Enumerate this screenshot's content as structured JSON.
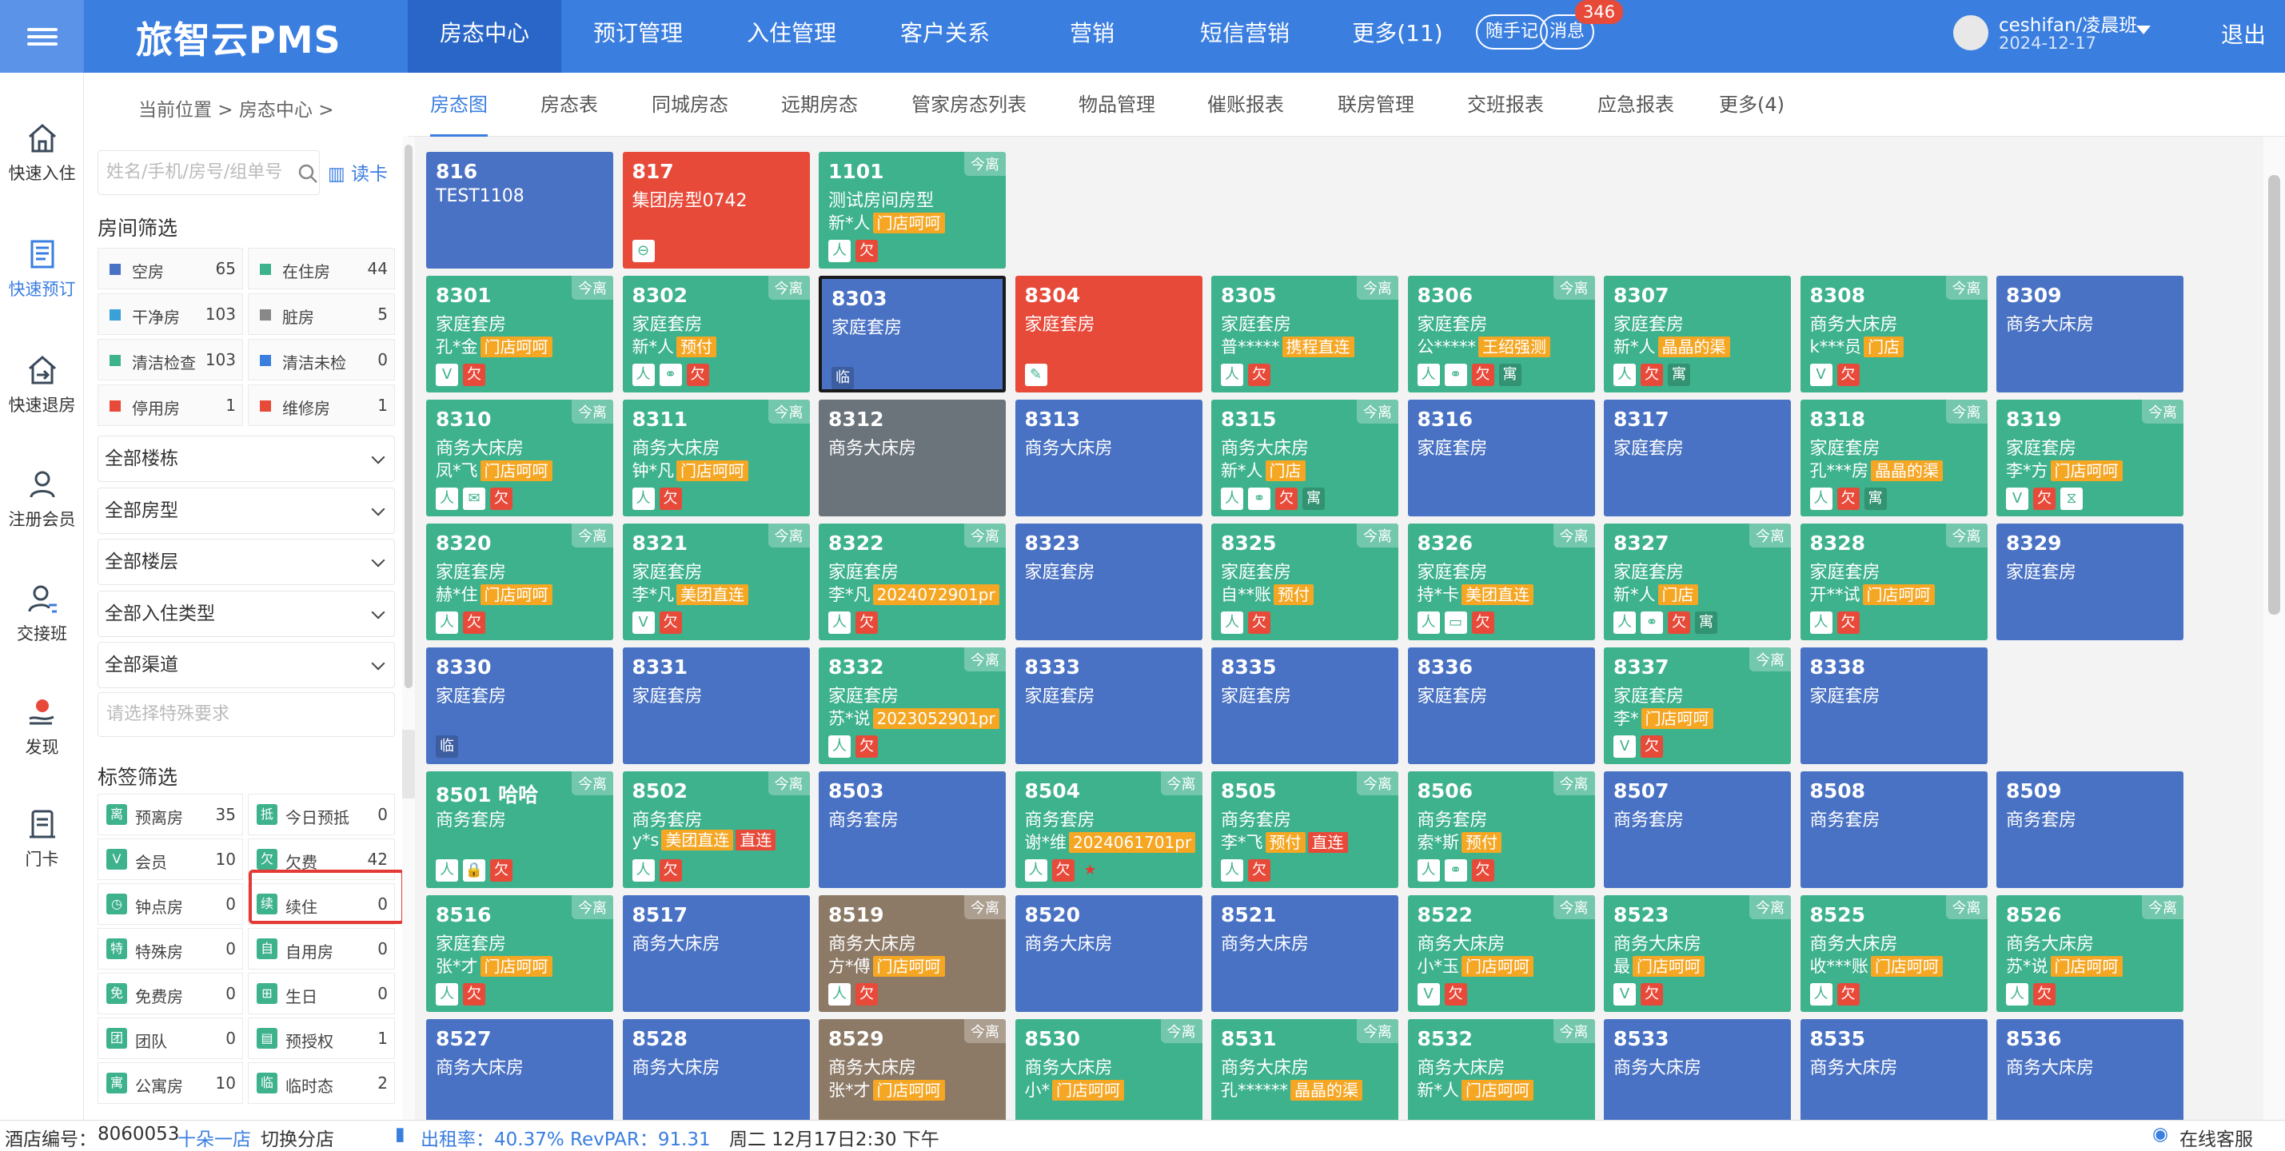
{
  "header": {
    "logo": "旅智云PMS",
    "nav": [
      "房态中心",
      "预订管理",
      "入住管理",
      "客户关系",
      "营销",
      "短信营销",
      "更多(11)"
    ],
    "pill_notes": "随手记",
    "pill_msg": "消息",
    "msg_count": "346",
    "user": "ceshifan/凌晨班",
    "date": "2024-12-17",
    "logout": "退出"
  },
  "leftbar": [
    "快速入住",
    "快速预订",
    "快速退房",
    "注册会员",
    "交接班",
    "发现",
    "门卡"
  ],
  "breadcrumb": "当前位置  >  房态中心  >",
  "tabs": [
    "房态图",
    "房态表",
    "同城房态",
    "远期房态",
    "管家房态列表",
    "物品管理",
    "催账报表",
    "联房管理",
    "交班报表",
    "应急报表",
    "更多(4)"
  ],
  "sidebar": {
    "search_placeholder": "姓名/手机/房号/组单号",
    "card_read": "读卡",
    "room_filter_title": "房间筛选",
    "status_filters": [
      {
        "label": "空房",
        "count": "65",
        "color": "#4a72c4"
      },
      {
        "label": "在住房",
        "count": "44",
        "color": "#3db28c"
      },
      {
        "label": "干净房",
        "count": "103",
        "color": "#3aa0d8"
      },
      {
        "label": "脏房",
        "count": "5",
        "color": "#888888"
      },
      {
        "label": "清洁检查",
        "count": "103",
        "color": "#3db28c"
      },
      {
        "label": "清洁未检",
        "count": "0",
        "color": "#3a7ee0"
      },
      {
        "label": "停用房",
        "count": "1",
        "color": "#e84a3a"
      },
      {
        "label": "维修房",
        "count": "1",
        "color": "#e84a3a"
      }
    ],
    "dropdowns": [
      "全部楼栋",
      "全部房型",
      "全部楼层",
      "全部入住类型",
      "全部渠道"
    ],
    "special_placeholder": "请选择特殊要求",
    "tag_filter_title": "标签筛选",
    "tag_filters": [
      {
        "icon": "离",
        "label": "预离房",
        "count": "35",
        "color": "#3db28c"
      },
      {
        "icon": "抵",
        "label": "今日预抵",
        "count": "0",
        "color": "#3db28c"
      },
      {
        "icon": "V",
        "label": "会员",
        "count": "10",
        "color": "#3db28c"
      },
      {
        "icon": "欠",
        "label": "欠费",
        "count": "42",
        "color": "#3db28c"
      },
      {
        "icon": "◷",
        "label": "钟点房",
        "count": "0",
        "color": "#3db28c"
      },
      {
        "icon": "续",
        "label": "续住",
        "count": "0",
        "color": "#3db28c"
      },
      {
        "icon": "特",
        "label": "特殊房",
        "count": "0",
        "color": "#3db28c"
      },
      {
        "icon": "自",
        "label": "自用房",
        "count": "0",
        "color": "#3db28c"
      },
      {
        "icon": "免",
        "label": "免费房",
        "count": "0",
        "color": "#3db28c"
      },
      {
        "icon": "⊞",
        "label": "生日",
        "count": "0",
        "color": "#3db28c"
      },
      {
        "icon": "团",
        "label": "团队",
        "count": "0",
        "color": "#3db28c"
      },
      {
        "icon": "▤",
        "label": "预授权",
        "count": "1",
        "color": "#3db28c"
      },
      {
        "icon": "寓",
        "label": "公寓房",
        "count": "10",
        "color": "#3db28c"
      },
      {
        "icon": "临",
        "label": "临时态",
        "count": "2",
        "color": "#3db28c"
      }
    ]
  },
  "colors": {
    "blue": "#4a72c4",
    "green": "#3db28c",
    "red": "#e84a3a",
    "gray": "#6b737b",
    "brown": "#8c7a66"
  },
  "rooms": [
    {
      "num": "816",
      "type": "TEST1108",
      "guest": "",
      "tag": "",
      "tag2": "",
      "badge": "",
      "icons": [],
      "color": "blue"
    },
    {
      "num": "817",
      "type": "集团房型0742",
      "guest": "",
      "tag": "",
      "tag2": "",
      "badge": "",
      "icons": [
        "⊖"
      ],
      "color": "red"
    },
    {
      "num": "1101",
      "type": "测试房间房型",
      "guest": "新*人",
      "tag": "门店呵呵",
      "tag2": "",
      "badge": "今离",
      "icons": [
        "人",
        "欠"
      ],
      "color": "green"
    },
    {
      "num": "8301",
      "type": "家庭套房",
      "guest": "孔*金",
      "tag": "门店呵呵",
      "tag2": "",
      "badge": "今离",
      "icons": [
        "V",
        "欠"
      ],
      "color": "green"
    },
    {
      "num": "8302",
      "type": "家庭套房",
      "guest": "新*人",
      "tag": "预付",
      "tag2": "",
      "badge": "今离",
      "icons": [
        "人",
        "⚭",
        "欠"
      ],
      "color": "green"
    },
    {
      "num": "8303",
      "type": "家庭套房",
      "guest": "",
      "tag": "",
      "tag2": "",
      "badge": "",
      "icons": [
        "临"
      ],
      "color": "blue",
      "sel": true
    },
    {
      "num": "8304",
      "type": "家庭套房",
      "guest": "",
      "tag": "",
      "tag2": "",
      "badge": "",
      "icons": [
        "✎"
      ],
      "color": "red"
    },
    {
      "num": "8305",
      "type": "家庭套房",
      "guest": "普*****",
      "tag": "携程直连",
      "tag2": "",
      "badge": "今离",
      "icons": [
        "人",
        "欠"
      ],
      "color": "green"
    },
    {
      "num": "8306",
      "type": "家庭套房",
      "guest": "公*****",
      "tag": "王绍强测",
      "tag2": "",
      "badge": "今离",
      "icons": [
        "人",
        "⚭",
        "欠",
        "寓"
      ],
      "color": "green"
    },
    {
      "num": "8307",
      "type": "家庭套房",
      "guest": "新*人",
      "tag": "晶晶的渠",
      "tag2": "",
      "badge": "",
      "icons": [
        "人",
        "欠",
        "寓"
      ],
      "color": "green"
    },
    {
      "num": "8308",
      "type": "商务大床房",
      "guest": "k***员",
      "tag": "门店",
      "tag2": "",
      "badge": "今离",
      "icons": [
        "V",
        "欠"
      ],
      "color": "green"
    },
    {
      "num": "8309",
      "type": "商务大床房",
      "guest": "",
      "tag": "",
      "tag2": "",
      "badge": "",
      "icons": [],
      "color": "blue"
    },
    {
      "num": "8310",
      "type": "商务大床房",
      "guest": "凤*飞",
      "tag": "门店呵呵",
      "tag2": "",
      "badge": "今离",
      "icons": [
        "人",
        "✉",
        "欠"
      ],
      "color": "green"
    },
    {
      "num": "8311",
      "type": "商务大床房",
      "guest": "钟*凡",
      "tag": "门店呵呵",
      "tag2": "",
      "badge": "今离",
      "icons": [
        "人",
        "欠"
      ],
      "color": "green"
    },
    {
      "num": "8312",
      "type": "商务大床房",
      "guest": "",
      "tag": "",
      "tag2": "",
      "badge": "",
      "icons": [],
      "color": "gray"
    },
    {
      "num": "8313",
      "type": "商务大床房",
      "guest": "",
      "tag": "",
      "tag2": "",
      "badge": "",
      "icons": [],
      "color": "blue"
    },
    {
      "num": "8315",
      "type": "商务大床房",
      "guest": "新*人",
      "tag": "门店",
      "tag2": "",
      "badge": "今离",
      "icons": [
        "人",
        "⚭",
        "欠",
        "寓"
      ],
      "color": "green"
    },
    {
      "num": "8316",
      "type": "家庭套房",
      "guest": "",
      "tag": "",
      "tag2": "",
      "badge": "",
      "icons": [],
      "color": "blue"
    },
    {
      "num": "8317",
      "type": "家庭套房",
      "guest": "",
      "tag": "",
      "tag2": "",
      "badge": "",
      "icons": [],
      "color": "blue"
    },
    {
      "num": "8318",
      "type": "家庭套房",
      "guest": "孔***房",
      "tag": "晶晶的渠",
      "tag2": "",
      "badge": "今离",
      "icons": [
        "人",
        "欠",
        "寓"
      ],
      "color": "green"
    },
    {
      "num": "8319",
      "type": "家庭套房",
      "guest": "李*方",
      "tag": "门店呵呵",
      "tag2": "",
      "badge": "今离",
      "icons": [
        "V",
        "欠",
        "⧖"
      ],
      "color": "green"
    },
    {
      "num": "8320",
      "type": "家庭套房",
      "guest": "赫*住",
      "tag": "门店呵呵",
      "tag2": "",
      "badge": "今离",
      "icons": [
        "人",
        "欠"
      ],
      "color": "green"
    },
    {
      "num": "8321",
      "type": "家庭套房",
      "guest": "李*凡",
      "tag": "美团直连",
      "tag2": "",
      "badge": "今离",
      "icons": [
        "V",
        "欠"
      ],
      "color": "green"
    },
    {
      "num": "8322",
      "type": "家庭套房",
      "guest": "李*凡",
      "tag": "2024072901pr",
      "tag2": "",
      "badge": "今离",
      "icons": [
        "人",
        "欠"
      ],
      "color": "green"
    },
    {
      "num": "8323",
      "type": "家庭套房",
      "guest": "",
      "tag": "",
      "tag2": "",
      "badge": "",
      "icons": [],
      "color": "blue"
    },
    {
      "num": "8325",
      "type": "家庭套房",
      "guest": "自**账",
      "tag": "预付",
      "tag2": "",
      "badge": "今离",
      "icons": [
        "人",
        "欠"
      ],
      "color": "green"
    },
    {
      "num": "8326",
      "type": "家庭套房",
      "guest": "持*卡",
      "tag": "美团直连",
      "tag2": "",
      "badge": "今离",
      "icons": [
        "人",
        "▭",
        "欠"
      ],
      "color": "green"
    },
    {
      "num": "8327",
      "type": "家庭套房",
      "guest": "新*人",
      "tag": "门店",
      "tag2": "",
      "badge": "今离",
      "icons": [
        "人",
        "⚭",
        "欠",
        "寓"
      ],
      "color": "green"
    },
    {
      "num": "8328",
      "type": "家庭套房",
      "guest": "开**试",
      "tag": "门店呵呵",
      "tag2": "",
      "badge": "今离",
      "icons": [
        "人",
        "欠"
      ],
      "color": "green"
    },
    {
      "num": "8329",
      "type": "家庭套房",
      "guest": "",
      "tag": "",
      "tag2": "",
      "badge": "",
      "icons": [],
      "color": "blue"
    },
    {
      "num": "8330",
      "type": "家庭套房",
      "guest": "",
      "tag": "",
      "tag2": "",
      "badge": "",
      "icons": [
        "临"
      ],
      "color": "blue"
    },
    {
      "num": "8331",
      "type": "家庭套房",
      "guest": "",
      "tag": "",
      "tag2": "",
      "badge": "",
      "icons": [],
      "color": "blue"
    },
    {
      "num": "8332",
      "type": "家庭套房",
      "guest": "苏*说",
      "tag": "2023052901pr",
      "tag2": "",
      "badge": "今离",
      "icons": [
        "人",
        "欠"
      ],
      "color": "green"
    },
    {
      "num": "8333",
      "type": "家庭套房",
      "guest": "",
      "tag": "",
      "tag2": "",
      "badge": "",
      "icons": [],
      "color": "blue"
    },
    {
      "num": "8335",
      "type": "家庭套房",
      "guest": "",
      "tag": "",
      "tag2": "",
      "badge": "",
      "icons": [],
      "color": "blue"
    },
    {
      "num": "8336",
      "type": "家庭套房",
      "guest": "",
      "tag": "",
      "tag2": "",
      "badge": "",
      "icons": [],
      "color": "blue"
    },
    {
      "num": "8337",
      "type": "家庭套房",
      "guest": "李*",
      "tag": "门店呵呵",
      "tag2": "",
      "badge": "今离",
      "icons": [
        "V",
        "欠"
      ],
      "color": "green"
    },
    {
      "num": "8338",
      "type": "家庭套房",
      "guest": "",
      "tag": "",
      "tag2": "",
      "badge": "",
      "icons": [],
      "color": "blue"
    },
    {
      "num": "8501 哈哈",
      "type": "商务套房",
      "guest": "",
      "tag": "",
      "tag2": "",
      "badge": "今离",
      "icons": [
        "人",
        "🔒",
        "欠"
      ],
      "color": "green"
    },
    {
      "num": "8502",
      "type": "商务套房",
      "guest": "y*s",
      "tag": "美团直连",
      "tag2": "直连",
      "badge": "今离",
      "icons": [
        "人",
        "欠"
      ],
      "color": "green"
    },
    {
      "num": "8503",
      "type": "商务套房",
      "guest": "",
      "tag": "",
      "tag2": "",
      "badge": "",
      "icons": [],
      "color": "blue"
    },
    {
      "num": "8504",
      "type": "商务套房",
      "guest": "谢*维",
      "tag": "2024061701pr",
      "tag2": "",
      "badge": "今离",
      "icons": [
        "人",
        "欠",
        "★"
      ],
      "color": "green"
    },
    {
      "num": "8505",
      "type": "商务套房",
      "guest": "李*飞",
      "tag": "预付",
      "tag2": "直连",
      "badge": "今离",
      "icons": [
        "人",
        "欠"
      ],
      "color": "green"
    },
    {
      "num": "8506",
      "type": "商务套房",
      "guest": "索*斯",
      "tag": "预付",
      "tag2": "",
      "badge": "今离",
      "icons": [
        "人",
        "⚭",
        "欠"
      ],
      "color": "green"
    },
    {
      "num": "8507",
      "type": "商务套房",
      "guest": "",
      "tag": "",
      "tag2": "",
      "badge": "",
      "icons": [],
      "color": "blue"
    },
    {
      "num": "8508",
      "type": "商务套房",
      "guest": "",
      "tag": "",
      "tag2": "",
      "badge": "",
      "icons": [],
      "color": "blue"
    },
    {
      "num": "8509",
      "type": "商务套房",
      "guest": "",
      "tag": "",
      "tag2": "",
      "badge": "",
      "icons": [],
      "color": "blue"
    },
    {
      "num": "8516",
      "type": "家庭套房",
      "guest": "张*才",
      "tag": "门店呵呵",
      "tag2": "",
      "badge": "今离",
      "icons": [
        "人",
        "欠"
      ],
      "color": "green"
    },
    {
      "num": "8517",
      "type": "商务大床房",
      "guest": "",
      "tag": "",
      "tag2": "",
      "badge": "",
      "icons": [],
      "color": "blue"
    },
    {
      "num": "8519",
      "type": "商务大床房",
      "guest": "方*傅",
      "tag": "门店呵呵",
      "tag2": "",
      "badge": "今离",
      "icons": [
        "人",
        "欠"
      ],
      "color": "brown"
    },
    {
      "num": "8520",
      "type": "商务大床房",
      "guest": "",
      "tag": "",
      "tag2": "",
      "badge": "",
      "icons": [],
      "color": "blue"
    },
    {
      "num": "8521",
      "type": "商务大床房",
      "guest": "",
      "tag": "",
      "tag2": "",
      "badge": "",
      "icons": [],
      "color": "blue"
    },
    {
      "num": "8522",
      "type": "商务大床房",
      "guest": "小*玉",
      "tag": "门店呵呵",
      "tag2": "",
      "badge": "今离",
      "icons": [
        "V",
        "欠"
      ],
      "color": "green"
    },
    {
      "num": "8523",
      "type": "商务大床房",
      "guest": "最",
      "tag": "门店呵呵",
      "tag2": "",
      "badge": "今离",
      "icons": [
        "V",
        "欠"
      ],
      "color": "green"
    },
    {
      "num": "8525",
      "type": "商务大床房",
      "guest": "收***账",
      "tag": "门店呵呵",
      "tag2": "",
      "badge": "今离",
      "icons": [
        "人",
        "欠"
      ],
      "color": "green"
    },
    {
      "num": "8526",
      "type": "商务大床房",
      "guest": "苏*说",
      "tag": "门店呵呵",
      "tag2": "",
      "badge": "今离",
      "icons": [
        "人",
        "欠"
      ],
      "color": "green"
    },
    {
      "num": "8527",
      "type": "商务大床房",
      "guest": "",
      "tag": "",
      "tag2": "",
      "badge": "",
      "icons": [],
      "color": "blue"
    },
    {
      "num": "8528",
      "type": "商务大床房",
      "guest": "",
      "tag": "",
      "tag2": "",
      "badge": "",
      "icons": [],
      "color": "blue"
    },
    {
      "num": "8529",
      "type": "商务大床房",
      "guest": "张*才",
      "tag": "门店呵呵",
      "tag2": "",
      "badge": "今离",
      "icons": [],
      "color": "brown"
    },
    {
      "num": "8530",
      "type": "商务大床房",
      "guest": "小*",
      "tag": "门店呵呵",
      "tag2": "",
      "badge": "今离",
      "icons": [],
      "color": "green"
    },
    {
      "num": "8531",
      "type": "商务大床房",
      "guest": "孔******",
      "tag": "晶晶的渠",
      "tag2": "",
      "badge": "今离",
      "icons": [],
      "color": "green"
    },
    {
      "num": "8532",
      "type": "商务大床房",
      "guest": "新*人",
      "tag": "门店呵呵",
      "tag2": "",
      "badge": "今离",
      "icons": [],
      "color": "green"
    },
    {
      "num": "8533",
      "type": "商务大床房",
      "guest": "",
      "tag": "",
      "tag2": "",
      "badge": "",
      "icons": [],
      "color": "blue"
    },
    {
      "num": "8535",
      "type": "商务大床房",
      "guest": "",
      "tag": "",
      "tag2": "",
      "badge": "",
      "icons": [],
      "color": "blue"
    },
    {
      "num": "8536",
      "type": "商务大床房",
      "guest": "",
      "tag": "",
      "tag2": "",
      "badge": "",
      "icons": [],
      "color": "blue"
    }
  ],
  "statusbar": {
    "hotel_label": "酒店编号：",
    "hotel_no": "8060053",
    "hotel_name": "十朵一店",
    "switch": "切换分店",
    "occupancy": "出租率：40.37% RevPAR：91.31",
    "datetime": "周二 12月17日2:30 下午",
    "support": "在线客服"
  }
}
